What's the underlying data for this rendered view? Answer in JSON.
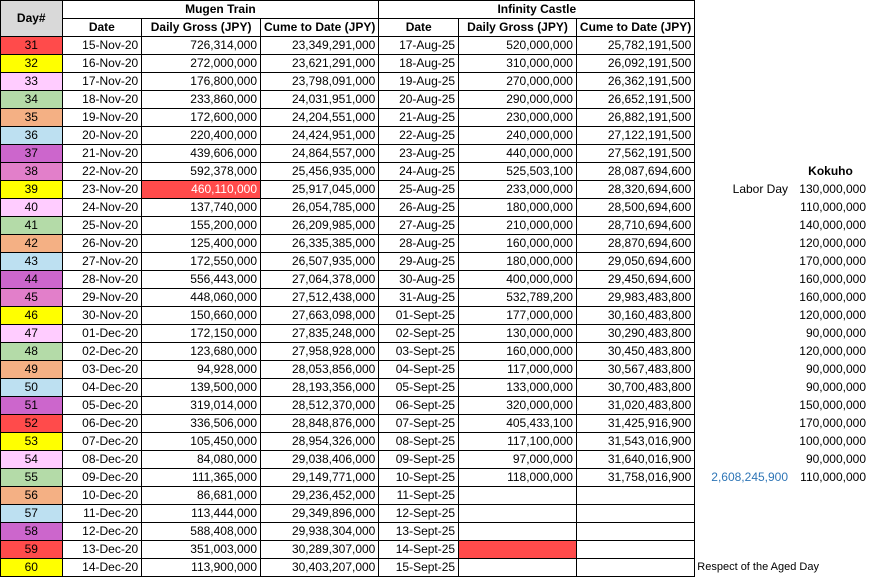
{
  "colors": {
    "red": "#ff4b4b",
    "yellow": "#ffff00",
    "lavender": "#ffccff",
    "green": "#b4dba8",
    "orange": "#f4b084",
    "blue": "#bde0f1",
    "purple": "#cc66cc",
    "pink": "#e27fca",
    "highlight": "#ff4b4b",
    "header_gray": "#d9d9d9",
    "link_blue": "#2e75b6"
  },
  "headers": {
    "day": "Day#",
    "mugen_title": "Mugen Train",
    "infinity_title": "Infinity Castle",
    "date": "Date",
    "daily_gross": "Daily Gross (JPY)",
    "cume": "Cume to Date (JPY)",
    "kokuho": "Kokuho"
  },
  "rows": [
    {
      "day": "31",
      "color": "#ff4b4b",
      "m_date": "15-Nov-20",
      "m_daily": "726,314,000",
      "m_cume": "23,349,291,000",
      "i_date": "17-Aug-25",
      "i_daily": "520,000,000",
      "i_cume": "25,782,191,500",
      "note": "",
      "k": ""
    },
    {
      "day": "32",
      "color": "#ffff00",
      "m_date": "16-Nov-20",
      "m_daily": "272,000,000",
      "m_cume": "23,621,291,000",
      "i_date": "18-Aug-25",
      "i_daily": "310,000,000",
      "i_cume": "26,092,191,500",
      "note": "",
      "k": ""
    },
    {
      "day": "33",
      "color": "#ffccff",
      "m_date": "17-Nov-20",
      "m_daily": "176,800,000",
      "m_cume": "23,798,091,000",
      "i_date": "19-Aug-25",
      "i_daily": "270,000,000",
      "i_cume": "26,362,191,500",
      "note": "",
      "k": ""
    },
    {
      "day": "34",
      "color": "#b4dba8",
      "m_date": "18-Nov-20",
      "m_daily": "233,860,000",
      "m_cume": "24,031,951,000",
      "i_date": "20-Aug-25",
      "i_daily": "290,000,000",
      "i_cume": "26,652,191,500",
      "note": "",
      "k": ""
    },
    {
      "day": "35",
      "color": "#f4b084",
      "m_date": "19-Nov-20",
      "m_daily": "172,600,000",
      "m_cume": "24,204,551,000",
      "i_date": "21-Aug-25",
      "i_daily": "230,000,000",
      "i_cume": "26,882,191,500",
      "note": "",
      "k": ""
    },
    {
      "day": "36",
      "color": "#bde0f1",
      "m_date": "20-Nov-20",
      "m_daily": "220,400,000",
      "m_cume": "24,424,951,000",
      "i_date": "22-Aug-25",
      "i_daily": "240,000,000",
      "i_cume": "27,122,191,500",
      "note": "",
      "k": ""
    },
    {
      "day": "37",
      "color": "#cc66cc",
      "m_date": "21-Nov-20",
      "m_daily": "439,606,000",
      "m_cume": "24,864,557,000",
      "i_date": "23-Aug-25",
      "i_daily": "440,000,000",
      "i_cume": "27,562,191,500",
      "note": "",
      "k": ""
    },
    {
      "day": "38",
      "color": "#e27fca",
      "m_date": "22-Nov-20",
      "m_daily": "592,378,000",
      "m_cume": "25,456,935,000",
      "i_date": "24-Aug-25",
      "i_daily": "525,503,100",
      "i_cume": "28,087,694,600",
      "note": "",
      "k": ""
    },
    {
      "day": "39",
      "color": "#ffff00",
      "m_date": "23-Nov-20",
      "m_daily": "460,110,000",
      "m_cume": "25,917,045,000",
      "i_date": "25-Aug-25",
      "i_daily": "233,000,000",
      "i_cume": "28,320,694,600",
      "note": "Labor Day",
      "k": "130,000,000",
      "m_daily_hl": true
    },
    {
      "day": "40",
      "color": "#ffccff",
      "m_date": "24-Nov-20",
      "m_daily": "137,740,000",
      "m_cume": "26,054,785,000",
      "i_date": "26-Aug-25",
      "i_daily": "180,000,000",
      "i_cume": "28,500,694,600",
      "note": "",
      "k": "110,000,000"
    },
    {
      "day": "41",
      "color": "#b4dba8",
      "m_date": "25-Nov-20",
      "m_daily": "155,200,000",
      "m_cume": "26,209,985,000",
      "i_date": "27-Aug-25",
      "i_daily": "210,000,000",
      "i_cume": "28,710,694,600",
      "note": "",
      "k": "140,000,000"
    },
    {
      "day": "42",
      "color": "#f4b084",
      "m_date": "26-Nov-20",
      "m_daily": "125,400,000",
      "m_cume": "26,335,385,000",
      "i_date": "28-Aug-25",
      "i_daily": "160,000,000",
      "i_cume": "28,870,694,600",
      "note": "",
      "k": "120,000,000"
    },
    {
      "day": "43",
      "color": "#bde0f1",
      "m_date": "27-Nov-20",
      "m_daily": "172,550,000",
      "m_cume": "26,507,935,000",
      "i_date": "29-Aug-25",
      "i_daily": "180,000,000",
      "i_cume": "29,050,694,600",
      "note": "",
      "k": "170,000,000"
    },
    {
      "day": "44",
      "color": "#cc66cc",
      "m_date": "28-Nov-20",
      "m_daily": "556,443,000",
      "m_cume": "27,064,378,000",
      "i_date": "30-Aug-25",
      "i_daily": "400,000,000",
      "i_cume": "29,450,694,600",
      "note": "",
      "k": "160,000,000"
    },
    {
      "day": "45",
      "color": "#e27fca",
      "m_date": "29-Nov-20",
      "m_daily": "448,060,000",
      "m_cume": "27,512,438,000",
      "i_date": "31-Aug-25",
      "i_daily": "532,789,200",
      "i_cume": "29,983,483,800",
      "note": "",
      "k": "160,000,000"
    },
    {
      "day": "46",
      "color": "#ffff00",
      "m_date": "30-Nov-20",
      "m_daily": "150,660,000",
      "m_cume": "27,663,098,000",
      "i_date": "01-Sept-25",
      "i_daily": "177,000,000",
      "i_cume": "30,160,483,800",
      "note": "",
      "k": "120,000,000"
    },
    {
      "day": "47",
      "color": "#ffccff",
      "m_date": "01-Dec-20",
      "m_daily": "172,150,000",
      "m_cume": "27,835,248,000",
      "i_date": "02-Sept-25",
      "i_daily": "130,000,000",
      "i_cume": "30,290,483,800",
      "note": "",
      "k": "90,000,000"
    },
    {
      "day": "48",
      "color": "#b4dba8",
      "m_date": "02-Dec-20",
      "m_daily": "123,680,000",
      "m_cume": "27,958,928,000",
      "i_date": "03-Sept-25",
      "i_daily": "160,000,000",
      "i_cume": "30,450,483,800",
      "note": "",
      "k": "120,000,000"
    },
    {
      "day": "49",
      "color": "#f4b084",
      "m_date": "03-Dec-20",
      "m_daily": "94,928,000",
      "m_cume": "28,053,856,000",
      "i_date": "04-Sept-25",
      "i_daily": "117,000,000",
      "i_cume": "30,567,483,800",
      "note": "",
      "k": "90,000,000"
    },
    {
      "day": "50",
      "color": "#bde0f1",
      "m_date": "04-Dec-20",
      "m_daily": "139,500,000",
      "m_cume": "28,193,356,000",
      "i_date": "05-Sept-25",
      "i_daily": "133,000,000",
      "i_cume": "30,700,483,800",
      "note": "",
      "k": "90,000,000"
    },
    {
      "day": "51",
      "color": "#cc66cc",
      "m_date": "05-Dec-20",
      "m_daily": "319,014,000",
      "m_cume": "28,512,370,000",
      "i_date": "06-Sept-25",
      "i_daily": "320,000,000",
      "i_cume": "31,020,483,800",
      "note": "",
      "k": "150,000,000"
    },
    {
      "day": "52",
      "color": "#ff4b4b",
      "m_date": "06-Dec-20",
      "m_daily": "336,506,000",
      "m_cume": "28,848,876,000",
      "i_date": "07-Sept-25",
      "i_daily": "405,433,100",
      "i_cume": "31,425,916,900",
      "note": "",
      "k": "170,000,000"
    },
    {
      "day": "53",
      "color": "#ffff00",
      "m_date": "07-Dec-20",
      "m_daily": "105,450,000",
      "m_cume": "28,954,326,000",
      "i_date": "08-Sept-25",
      "i_daily": "117,100,000",
      "i_cume": "31,543,016,900",
      "note": "",
      "k": "100,000,000"
    },
    {
      "day": "54",
      "color": "#ffccff",
      "m_date": "08-Dec-20",
      "m_daily": "84,080,000",
      "m_cume": "29,038,406,000",
      "i_date": "09-Sept-25",
      "i_daily": "97,000,000",
      "i_cume": "31,640,016,900",
      "note": "",
      "k": "90,000,000"
    },
    {
      "day": "55",
      "color": "#b4dba8",
      "m_date": "09-Dec-20",
      "m_daily": "111,365,000",
      "m_cume": "29,149,771,000",
      "i_date": "10-Sept-25",
      "i_daily": "118,000,000",
      "i_cume": "31,758,016,900",
      "note": "2,608,245,900",
      "k": "110,000,000",
      "note_blue": true
    },
    {
      "day": "56",
      "color": "#f4b084",
      "m_date": "10-Dec-20",
      "m_daily": "86,681,000",
      "m_cume": "29,236,452,000",
      "i_date": "11-Sept-25",
      "i_daily": "",
      "i_cume": "",
      "note": "",
      "k": ""
    },
    {
      "day": "57",
      "color": "#bde0f1",
      "m_date": "11-Dec-20",
      "m_daily": "113,444,000",
      "m_cume": "29,349,896,000",
      "i_date": "12-Sept-25",
      "i_daily": "",
      "i_cume": "",
      "note": "",
      "k": ""
    },
    {
      "day": "58",
      "color": "#cc66cc",
      "m_date": "12-Dec-20",
      "m_daily": "588,408,000",
      "m_cume": "29,938,304,000",
      "i_date": "13-Sept-25",
      "i_daily": "",
      "i_cume": "",
      "note": "",
      "k": ""
    },
    {
      "day": "59",
      "color": "#ff4b4b",
      "m_date": "13-Dec-20",
      "m_daily": "351,003,000",
      "m_cume": "30,289,307,000",
      "i_date": "14-Sept-25",
      "i_daily": "",
      "i_cume": "",
      "note": "",
      "k": "",
      "i_daily_hl": true
    },
    {
      "day": "60",
      "color": "#ffff00",
      "m_date": "14-Dec-20",
      "m_daily": "113,900,000",
      "m_cume": "30,403,207,000",
      "i_date": "15-Sept-25",
      "i_daily": "",
      "i_cume": "",
      "note": "Respect of the Aged Day",
      "k": "",
      "note_small": true
    }
  ]
}
